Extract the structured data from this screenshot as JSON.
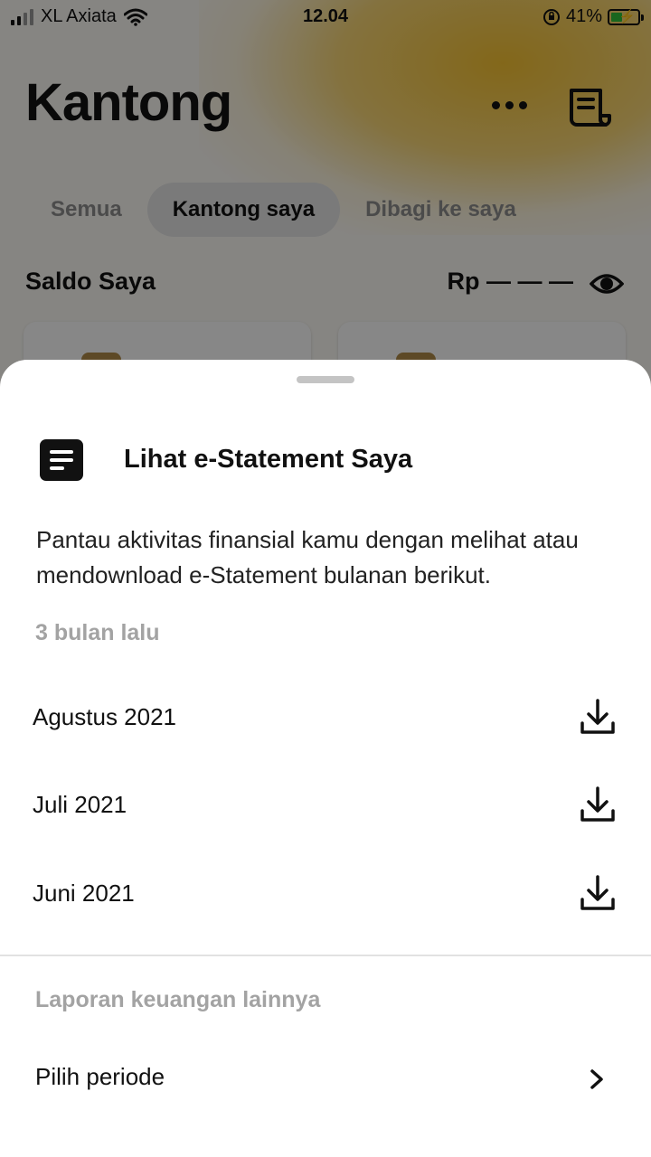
{
  "status_bar": {
    "carrier": "XL Axiata",
    "time": "12.04",
    "battery_percent": "41%"
  },
  "page": {
    "title": "Kantong",
    "tabs": [
      {
        "label": "Semua",
        "active": false
      },
      {
        "label": "Kantong saya",
        "active": true
      },
      {
        "label": "Dibagi ke saya",
        "active": false
      }
    ],
    "balance_label": "Saldo Saya",
    "balance_value": "Rp — — —"
  },
  "sheet": {
    "title": "Lihat e-Statement Saya",
    "description": "Pantau aktivitas finansial kamu dengan melihat atau mendownload e-Statement bulanan berikut.",
    "recent_label": "3 bulan lalu",
    "statements": [
      {
        "month": "Agustus 2021"
      },
      {
        "month": "Juli 2021"
      },
      {
        "month": "Juni 2021"
      }
    ],
    "other_label": "Laporan keuangan lainnya",
    "period_label": "Pilih periode"
  },
  "colors": {
    "accent": "#f7c332",
    "overlay": "#000000",
    "muted_text": "#a3a3a3"
  },
  "icons": [
    "signal-icon",
    "wifi-icon",
    "orientation-lock-icon",
    "battery-icon",
    "more-icon",
    "receipt-icon",
    "eye-icon",
    "document-icon",
    "download-icon",
    "chevron-right-icon"
  ]
}
